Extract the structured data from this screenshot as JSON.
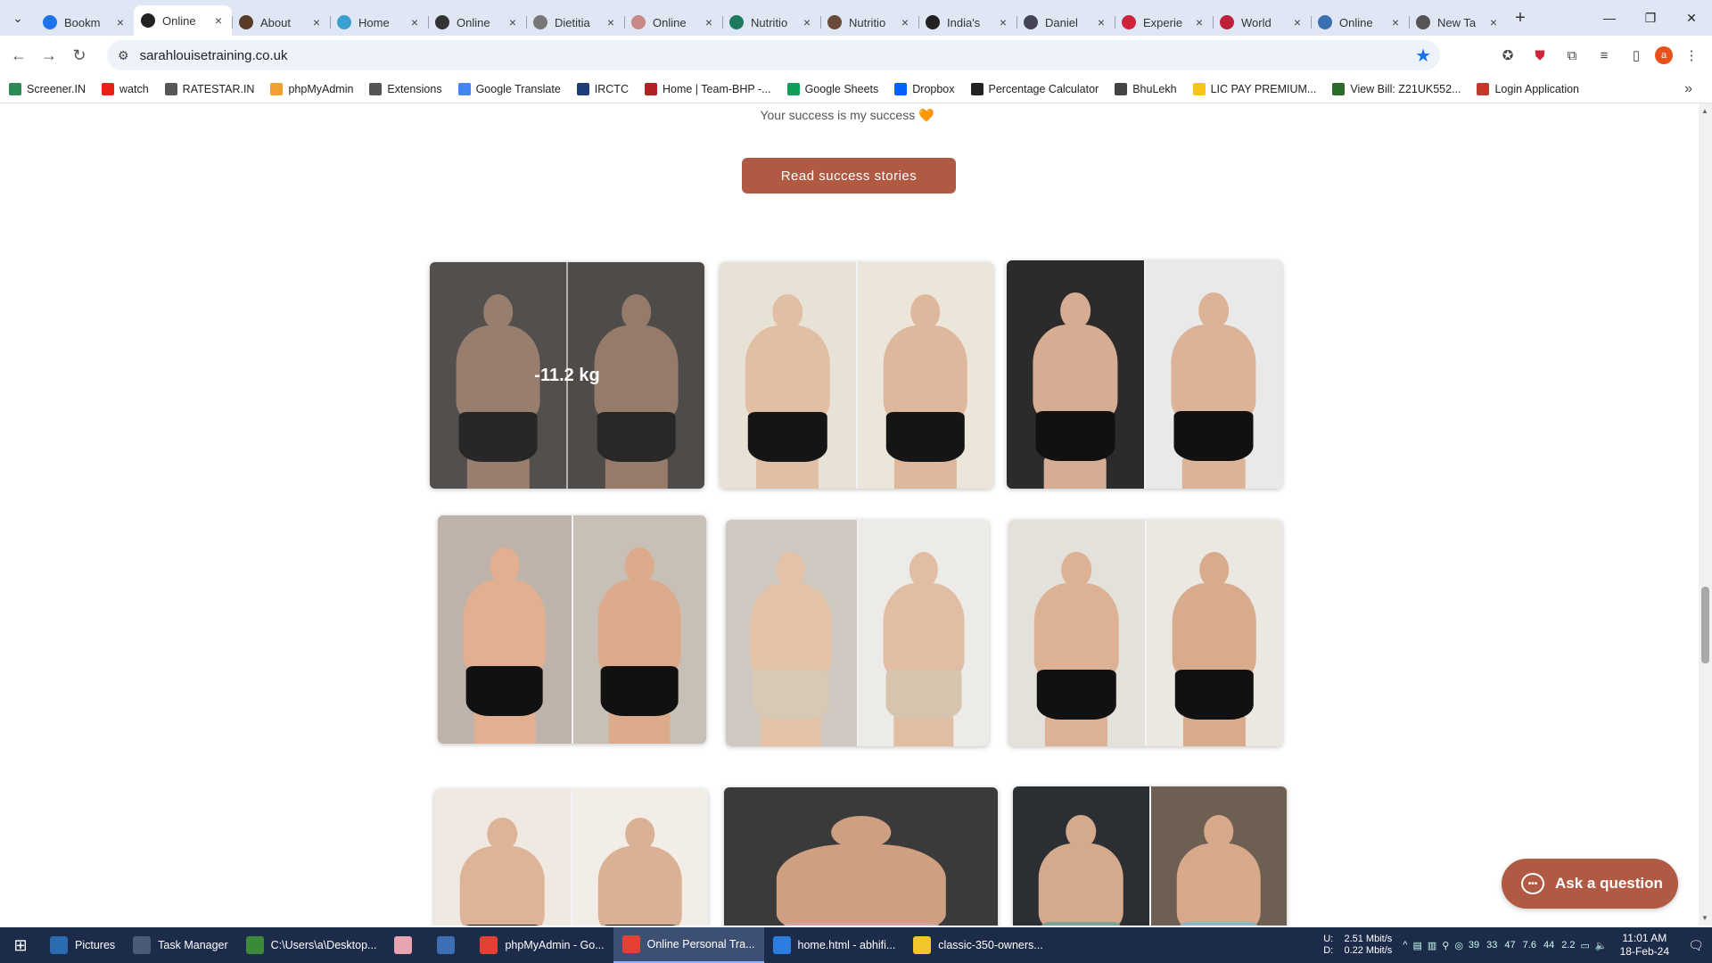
{
  "browser": {
    "tabs": [
      {
        "label": "Bookm",
        "icon": "star-icon",
        "color": "#1a73e8"
      },
      {
        "label": "Online",
        "icon": "site-icon",
        "color": "#222222",
        "active": true
      },
      {
        "label": "About",
        "icon": "site-icon",
        "color": "#5a3b2a"
      },
      {
        "label": "Home",
        "icon": "globe-icon",
        "color": "#3aa0d0"
      },
      {
        "label": "Online",
        "icon": "site-icon",
        "color": "#333333"
      },
      {
        "label": "Dietitia",
        "icon": "site-icon",
        "color": "#777777"
      },
      {
        "label": "Online",
        "icon": "site-icon",
        "color": "#c88"
      },
      {
        "label": "Nutritio",
        "icon": "site-icon",
        "color": "#1d7a5c"
      },
      {
        "label": "Nutritio",
        "icon": "site-icon",
        "color": "#6a4a3a"
      },
      {
        "label": "India's",
        "icon": "map-pin-icon",
        "color": "#222222"
      },
      {
        "label": "Daniel",
        "icon": "site-icon",
        "color": "#445"
      },
      {
        "label": "Experie",
        "icon": "site-icon",
        "color": "#d0223a"
      },
      {
        "label": "World",
        "icon": "site-icon",
        "color": "#c0203a"
      },
      {
        "label": "Online",
        "icon": "site-icon",
        "color": "#3a6fb0"
      },
      {
        "label": "New Ta",
        "icon": "chrome-icon",
        "color": "#555555"
      }
    ],
    "url": "sarahlouisetraining.co.uk",
    "avatar_letter": "a",
    "bookmarks": [
      {
        "label": "Screener.IN",
        "color": "#2e8b57"
      },
      {
        "label": "watch",
        "color": "#e62117"
      },
      {
        "label": "RATESTAR.IN",
        "color": "#555555"
      },
      {
        "label": "phpMyAdmin",
        "color": "#f0a030"
      },
      {
        "label": "Extensions",
        "color": "#555555"
      },
      {
        "label": "Google Translate",
        "color": "#4285f4"
      },
      {
        "label": "IRCTC",
        "color": "#1d3c78"
      },
      {
        "label": "Home | Team-BHP -...",
        "color": "#b22222"
      },
      {
        "label": "Google Sheets",
        "color": "#0f9d58"
      },
      {
        "label": "Dropbox",
        "color": "#0061ff"
      },
      {
        "label": "Percentage Calculator",
        "color": "#222222"
      },
      {
        "label": "BhuLekh",
        "color": "#444444"
      },
      {
        "label": "LIC PAY PREMIUM...",
        "color": "#f5c518"
      },
      {
        "label": "View Bill: Z21UK552...",
        "color": "#2a6a2a"
      },
      {
        "label": "Login Application",
        "color": "#c0392b"
      }
    ]
  },
  "page": {
    "tagline": "Your success is my success 🧡",
    "cta_label": "Read success stories",
    "photos": [
      {
        "overlay": "-11.2 kg",
        "left": {
          "bg": "#5f5956",
          "skin": "#c9a189",
          "short": "#1c1c1c"
        },
        "right": {
          "bg": "#5a5450",
          "skin": "#c69d85",
          "short": "#1e1e1e"
        }
      },
      {
        "left": {
          "bg": "#e8e2d6",
          "skin": "#e1bfa5",
          "short": "#151515"
        },
        "right": {
          "bg": "#ece6da",
          "skin": "#ddb89c",
          "short": "#151515"
        }
      },
      {
        "left": {
          "bg": "#2b2b2b",
          "skin": "#d6ad92",
          "short": "#111111"
        },
        "right": {
          "bg": "#e9e9e9",
          "skin": "#dcb396",
          "short": "#111111"
        }
      },
      {
        "left": {
          "bg": "#bdb3aa",
          "skin": "#e2b090",
          "short": "#111111"
        },
        "right": {
          "bg": "#c8bfb6",
          "skin": "#dcab8b",
          "short": "#111111"
        }
      },
      {
        "left": {
          "bg": "#cfc8c0",
          "skin": "#e3c2a8",
          "short": "#d8c9b5"
        },
        "right": {
          "bg": "#ecebe8",
          "skin": "#e0bda3",
          "short": "#d6c4ae"
        }
      },
      {
        "left": {
          "bg": "#e4e0da",
          "skin": "#ddb194",
          "short": "#111111"
        },
        "right": {
          "bg": "#ebe7e1",
          "skin": "#d9ab8d",
          "short": "#111111"
        }
      },
      {
        "left": {
          "bg": "#efe9e2",
          "skin": "#deb498",
          "short": "#151515"
        },
        "right": {
          "bg": "#f2ede6",
          "skin": "#dab194",
          "short": "#151515"
        }
      },
      {
        "left": {
          "bg": "#3a3a3a",
          "skin": "#cf9f82",
          "short": "#d9a0a8"
        }
      },
      {
        "left": {
          "bg": "#2b2f33",
          "skin": "#d4a98c",
          "short": "#7aa39a"
        },
        "right": {
          "bg": "#6d5f52",
          "skin": "#d7a98a",
          "short": "#8fb3c6"
        }
      }
    ],
    "ask_label": "Ask a question"
  },
  "taskbar": {
    "items": [
      {
        "label": "Pictures",
        "color": "#2b6cb0"
      },
      {
        "label": "Task Manager",
        "color": "#4a5b78"
      },
      {
        "label": "C:\\Users\\a\\Desktop...",
        "color": "#3a8a3a"
      },
      {
        "label": "",
        "color": "#e8a3b0"
      },
      {
        "label": "",
        "color": "#3c6fb4"
      },
      {
        "label": "phpMyAdmin - Go...",
        "color": "#e34133"
      },
      {
        "label": "Online Personal Tra...",
        "color": "#e34133",
        "active": true
      },
      {
        "label": "home.html - abhifi...",
        "color": "#2d7de0"
      },
      {
        "label": "classic-350-owners...",
        "color": "#f3c62e"
      }
    ],
    "net_up": "2.51 Mbit/s",
    "net_down": "0.22 Mbit/s",
    "net_up_label": "U:",
    "net_down_label": "D:",
    "tray_values": [
      "39",
      "33",
      "47",
      "7.6",
      "44",
      "2.2"
    ],
    "time": "11:01 AM",
    "date": "18-Feb-24"
  }
}
